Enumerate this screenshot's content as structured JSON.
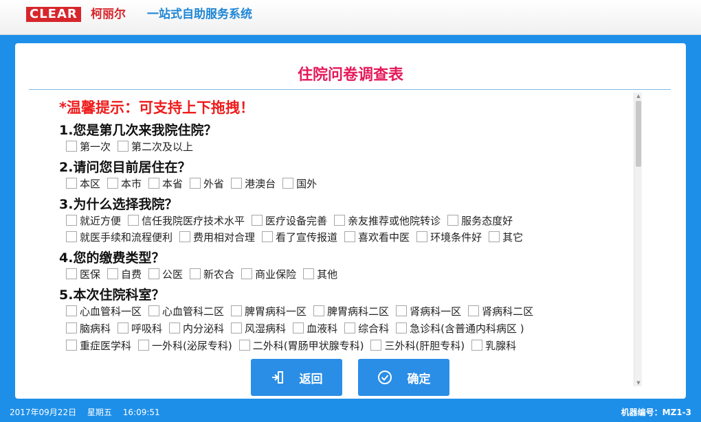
{
  "header": {
    "logo_text": "CLEAR",
    "brand_cn": "柯丽尔",
    "system_name": "一站式自助服务系统"
  },
  "survey": {
    "title": "住院问卷调查表",
    "tip": "*温馨提示：可支持上下拖拽！",
    "questions": [
      {
        "text": "1.您是第几次来我院住院？",
        "rows": [
          [
            "第一次",
            "第二次及以上"
          ]
        ]
      },
      {
        "text": "2.请问您目前居住在？",
        "rows": [
          [
            "本区",
            "本市",
            "本省",
            "外省",
            "港澳台",
            "国外"
          ]
        ]
      },
      {
        "text": "3.为什么选择我院？",
        "rows": [
          [
            "就近方便",
            "信任我院医疗技术水平",
            "医疗设备完善",
            "亲友推荐或他院转诊",
            "服务态度好"
          ],
          [
            "就医手续和流程便利",
            "费用相对合理",
            "看了宣传报道",
            "喜欢看中医",
            "环境条件好",
            "其它"
          ]
        ]
      },
      {
        "text": "4.您的缴费类型？",
        "rows": [
          [
            "医保",
            "自费",
            "公医",
            "新农合",
            "商业保险",
            "其他"
          ]
        ]
      },
      {
        "text": "5.本次住院科室？",
        "rows": [
          [
            "心血管科一区",
            "心血管科二区",
            "脾胃病科一区",
            "脾胃病科二区",
            "肾病科一区",
            "肾病科二区"
          ],
          [
            "脑病科",
            "呼吸科",
            "内分泌科",
            "风湿病科",
            "血液科",
            "综合科",
            "急诊科(含普通内科病区 )"
          ],
          [
            "重症医学科",
            "一外科(泌尿专科)",
            "二外科(胃肠甲状腺专科)",
            "三外科(肝胆专科)",
            "乳腺科"
          ]
        ]
      }
    ]
  },
  "buttons": {
    "back_label": "返回",
    "ok_label": "确定"
  },
  "footer": {
    "date": "2017年09月22日",
    "weekday": "星期五",
    "time": "16:09:51",
    "machine_id": "机器编号：MZ1-3"
  },
  "colors": {
    "background": "#1e8fe8",
    "title": "#e5195a",
    "tip": "#ee1c1c",
    "button": "#2b8ee6",
    "logo": "#d6262c",
    "system_name": "#1f86d6"
  }
}
